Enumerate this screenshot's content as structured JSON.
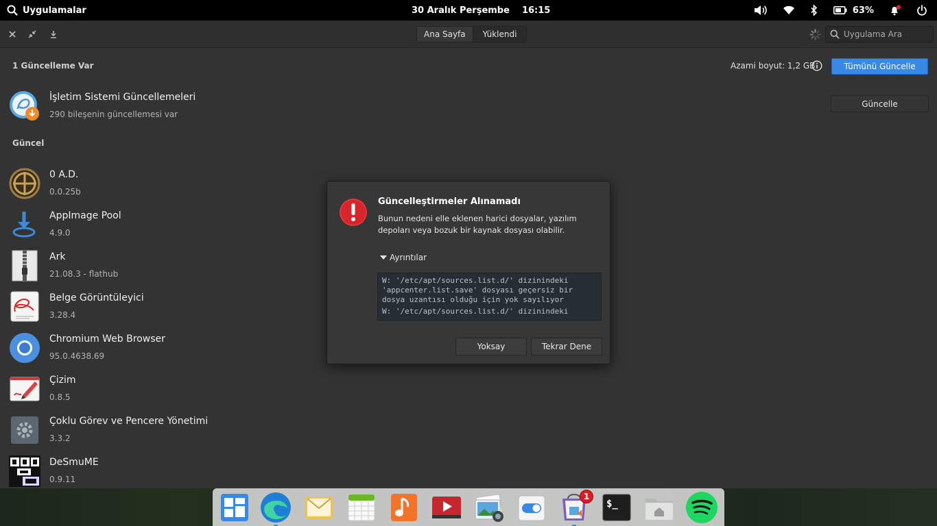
{
  "top_panel": {
    "app_label": "Uygulamalar",
    "date": "30 Aralık Perşembe",
    "time": "16:15",
    "battery": "63%"
  },
  "headerbar": {
    "tabs": [
      {
        "label": "Ana Sayfa",
        "active": false
      },
      {
        "label": "Yüklendi",
        "active": true
      }
    ],
    "search_placeholder": "Uygulama Ara"
  },
  "updates": {
    "section_title": "1 Güncelleme Var",
    "max_size": "Azami boyut: 1,2 GB",
    "update_all_label": "Tümünü Güncelle",
    "os_update": {
      "name": "İşletim Sistemi Güncellemeleri",
      "detail": "290 bileşenin güncellemesi var",
      "button": "Güncelle"
    }
  },
  "current": {
    "section_title": "Güncel",
    "apps": [
      {
        "name": "0 A.D.",
        "version": "0.0.25b",
        "icon": "0ad-icon"
      },
      {
        "name": "AppImage Pool",
        "version": "4.9.0",
        "icon": "appimage-pool-icon"
      },
      {
        "name": "Ark",
        "version": "21.08.3 - flathub",
        "icon": "ark-icon"
      },
      {
        "name": "Belge Görüntüleyici",
        "version": "3.28.4",
        "icon": "document-viewer-icon"
      },
      {
        "name": "Chromium Web Browser",
        "version": "95.0.4638.69",
        "icon": "chromium-icon"
      },
      {
        "name": "Çizim",
        "version": "0.8.5",
        "icon": "drawing-icon"
      },
      {
        "name": "Çoklu Görev ve Pencere Yönetimi",
        "version": "3.3.2",
        "icon": "multitasking-icon"
      },
      {
        "name": "DeSmuME",
        "version": "0.9.11",
        "icon": "desmume-icon"
      }
    ]
  },
  "dialog": {
    "title": "Güncelleştirmeler Alınamadı",
    "message": "Bunun nedeni elle eklenen harici dosyalar, yazılım depoları veya bozuk bir kaynak dosyası olabilir.",
    "details_label": "Ayrıntılar",
    "details_lines": [
      "W: '/etc/apt/sources.list.d/' dizinindeki",
      "'appcenter.list.save' dosyası geçersiz bir",
      "dosya uzantısı olduğu için yok sayılıyor",
      "W: '/etc/apt/sources.list.d/' dizinindeki"
    ],
    "ignore_button": "Yoksay",
    "retry_button": "Tekrar Dene"
  },
  "dock": {
    "items": [
      "multitasking-view",
      "edge",
      "mail",
      "calendar",
      "music",
      "videos",
      "photos",
      "settings",
      "appcenter",
      "terminal",
      "files",
      "spotify"
    ],
    "appcenter_badge": "1"
  },
  "colors": {
    "accent": "#3689e6",
    "error": "#e01b24",
    "window_bg": "#333333"
  }
}
